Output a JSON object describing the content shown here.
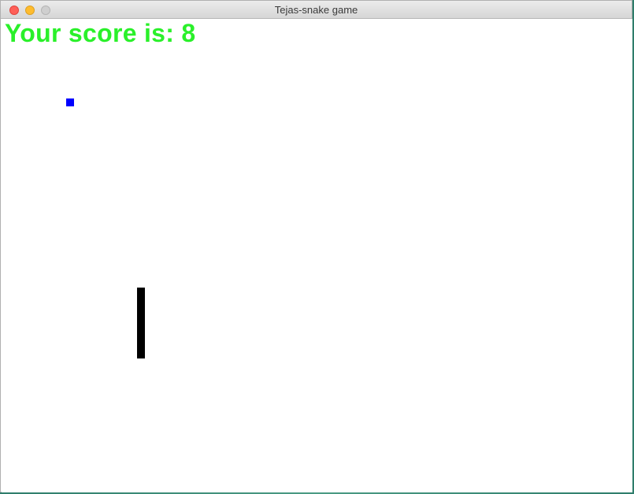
{
  "window": {
    "title": "Tejas-snake game"
  },
  "game": {
    "score_text": "Your score is: 8",
    "score_color": "#2af02a",
    "food_color": "#0000ff",
    "snake_color": "#000000",
    "background_color": "#ffffff"
  }
}
